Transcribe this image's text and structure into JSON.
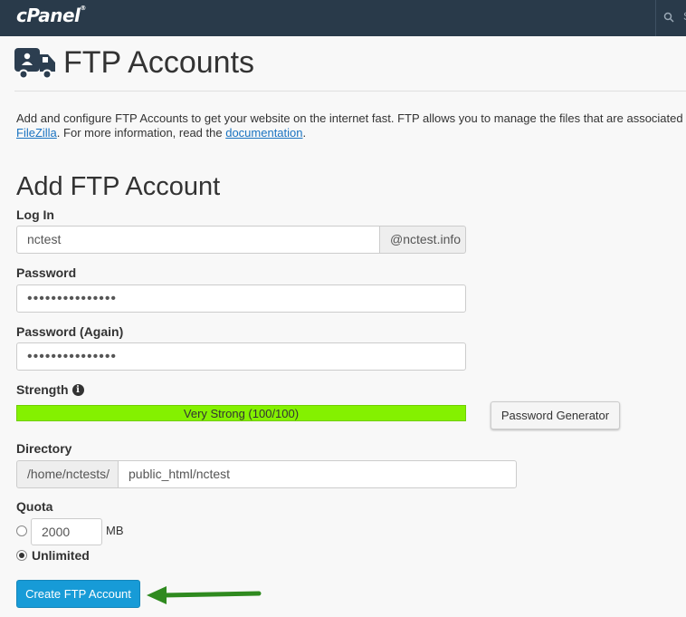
{
  "header": {
    "logo_text": "cPanel",
    "search_placeholder": "S"
  },
  "page": {
    "title": "FTP Accounts",
    "intro_text": "Add and configure FTP Accounts to get your website on the internet fast. FTP allows you to manage the files that are associated",
    "intro_link_filezilla": "FileZilla",
    "intro_middle": ". For more information, read the ",
    "intro_link_docs": "documentation",
    "intro_end": "."
  },
  "form": {
    "section_title": "Add FTP Account",
    "login_label": "Log In",
    "login_value": "nctest",
    "login_domain": "@nctest.info",
    "password_label": "Password",
    "password_value": "•••••••••••••••",
    "password_again_label": "Password (Again)",
    "password_again_value": "•••••••••••••••",
    "strength_label": "Strength",
    "strength_text": "Very Strong (100/100)",
    "strength_score": 100,
    "password_generator_label": "Password Generator",
    "directory_label": "Directory",
    "directory_prefix": "/home/nctests/",
    "directory_value": "public_html/nctest",
    "quota_label": "Quota",
    "quota_value": "2000",
    "quota_unit": "MB",
    "quota_unlimited_label": "Unlimited",
    "quota_selected": "unlimited",
    "create_button_label": "Create FTP Account"
  },
  "colors": {
    "topbar": "#293a4a",
    "strength_bar": "#84f100",
    "primary_button": "#179bd7",
    "annotation_arrow": "#2f8a1f"
  }
}
